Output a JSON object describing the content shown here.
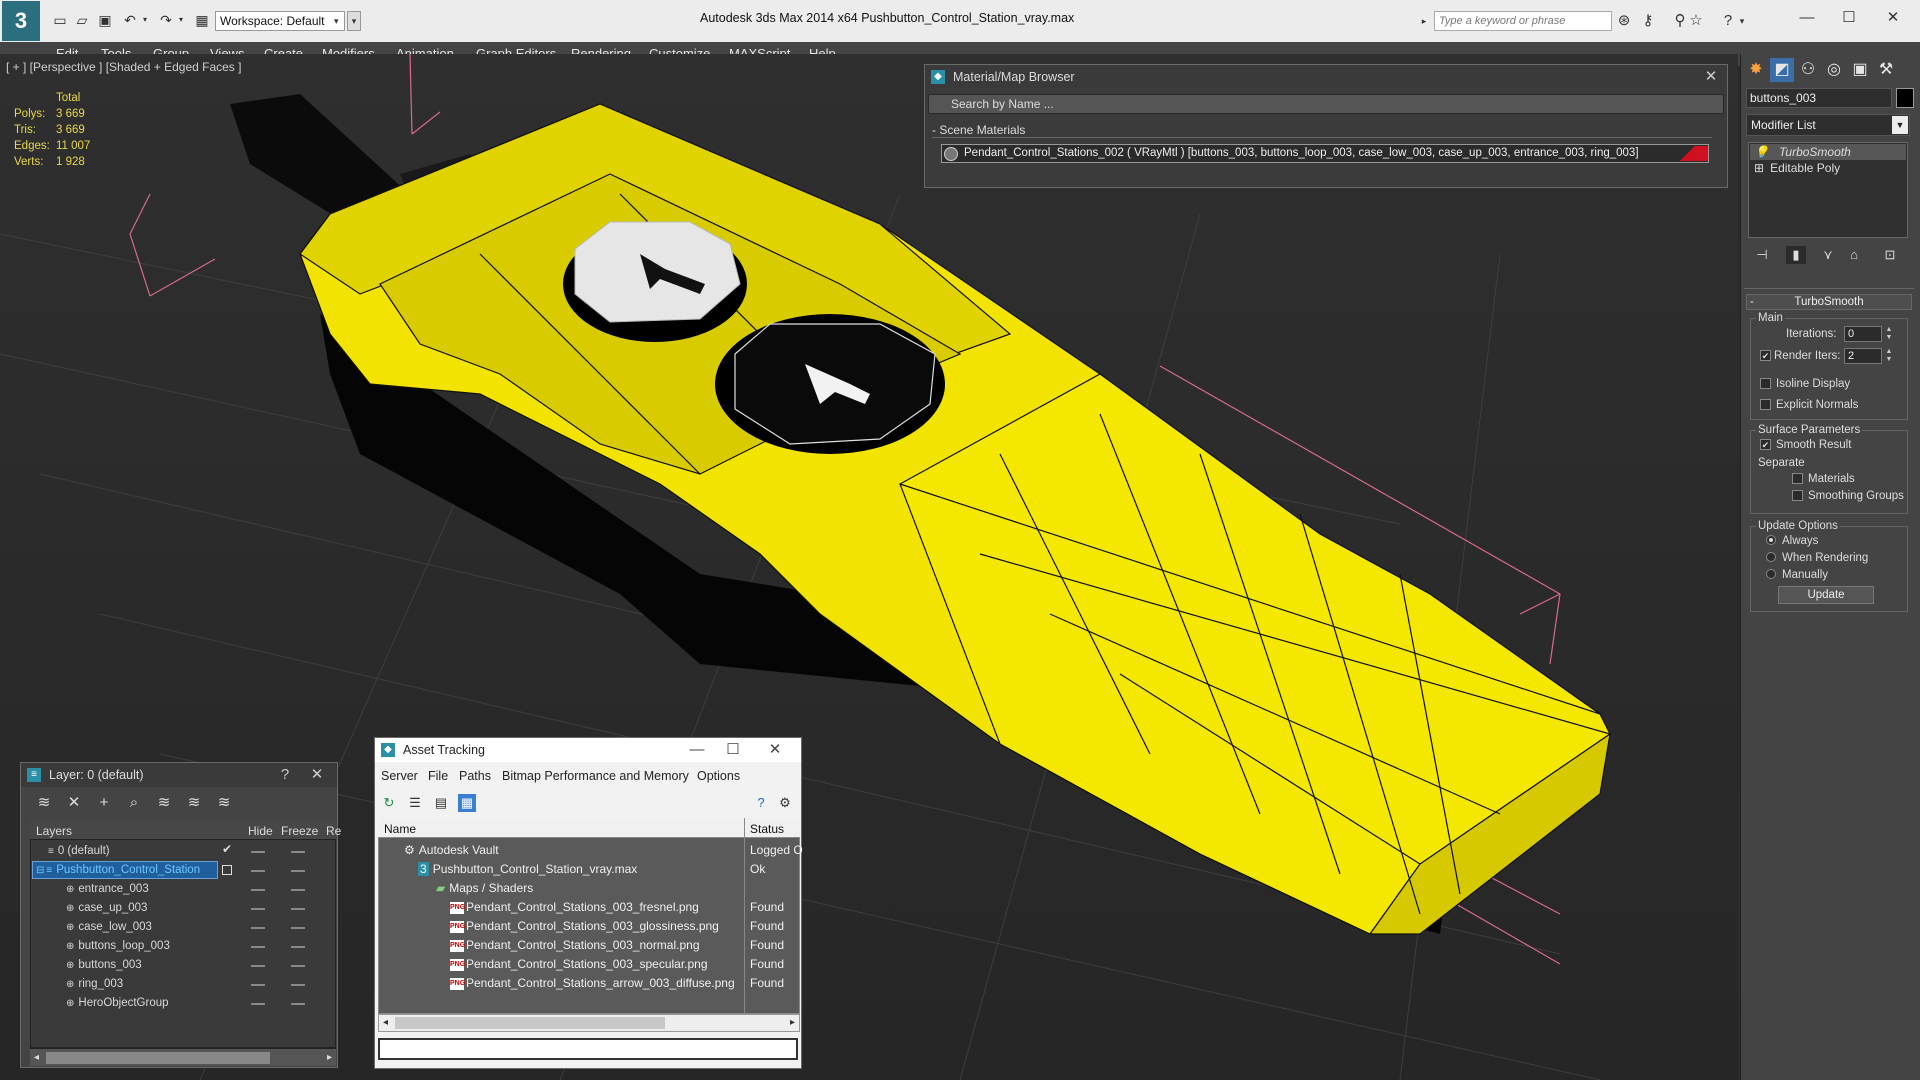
{
  "titlebar": {
    "workspace": "Workspace: Default",
    "app_title": "Autodesk 3ds Max  2014 x64      Pushbutton_Control_Station_vray.max",
    "search_placeholder": "Type a keyword or phrase"
  },
  "menu": [
    "Edit",
    "Tools",
    "Group",
    "Views",
    "Create",
    "Modifiers",
    "Animation",
    "Graph Editors",
    "Rendering",
    "Customize",
    "MAXScript",
    "Help"
  ],
  "viewport": {
    "label": "[ + ] [Perspective ] [Shaded + Edged Faces ]",
    "stats": {
      "header": "Total",
      "polys_label": "Polys:",
      "polys": "3 669",
      "tris_label": "Tris:",
      "tris": "3 669",
      "edges_label": "Edges:",
      "edges": "11 007",
      "verts_label": "Verts:",
      "verts": "1 928"
    }
  },
  "material_browser": {
    "title": "Material/Map Browser",
    "search_placeholder": "Search by Name ...",
    "section": "- Scene Materials",
    "material_row": "Pendant_Control_Stations_002  ( VRayMtl )  [buttons_003, buttons_loop_003, case_low_003, case_up_003, entrance_003, ring_003]",
    "swatch_color": "#d01020"
  },
  "layer_manager": {
    "title": "Layer: 0 (default)",
    "help": "?",
    "columns": {
      "layers": "Layers",
      "hide": "Hide",
      "freeze": "Freeze",
      "render": "Re"
    },
    "rows": [
      {
        "name": "0 (default)"
      },
      {
        "name": "Pushbutton_Control_Station"
      },
      {
        "name": "entrance_003"
      },
      {
        "name": "case_up_003"
      },
      {
        "name": "case_low_003"
      },
      {
        "name": "buttons_loop_003"
      },
      {
        "name": "buttons_003"
      },
      {
        "name": "ring_003"
      },
      {
        "name": "HeroObjectGroup"
      }
    ]
  },
  "asset_tracking": {
    "title": "Asset Tracking",
    "menu": [
      "Server",
      "File",
      "Paths",
      "Bitmap Performance and Memory",
      "Options"
    ],
    "columns": {
      "name": "Name",
      "status": "Status"
    },
    "rows": [
      {
        "name": "Autodesk Vault",
        "status": "Logged O"
      },
      {
        "name": "Pushbutton_Control_Station_vray.max",
        "status": "Ok"
      },
      {
        "name": "Maps / Shaders",
        "status": ""
      },
      {
        "name": "Pendant_Control_Stations_003_fresnel.png",
        "status": "Found"
      },
      {
        "name": "Pendant_Control_Stations_003_glossiness.png",
        "status": "Found"
      },
      {
        "name": "Pendant_Control_Stations_003_normal.png",
        "status": "Found"
      },
      {
        "name": "Pendant_Control_Stations_003_specular.png",
        "status": "Found"
      },
      {
        "name": "Pendant_Control_Stations_arrow_003_diffuse.png",
        "status": "Found"
      }
    ],
    "png_badge": "PNG"
  },
  "command_panel": {
    "object_name": "buttons_003",
    "modifier_list": "Modifier List",
    "stack": [
      "TurboSmooth",
      "Editable Poly"
    ],
    "rollout": "TurboSmooth",
    "main_label": "Main",
    "iterations_label": "Iterations:",
    "iterations": "0",
    "render_iters_label": "Render Iters:",
    "render_iters": "2",
    "isoline": "Isoline Display",
    "explicit_normals": "Explicit Normals",
    "surface_params": "Surface Parameters",
    "smooth_result": "Smooth Result",
    "separate": "Separate",
    "materials": "Materials",
    "smoothing_groups": "Smoothing Groups",
    "update_options": "Update Options",
    "always": "Always",
    "when_rendering": "When Rendering",
    "manually": "Manually",
    "update_button": "Update"
  },
  "colors": {
    "accent": "#2b8fa8",
    "model_yellow": "#f2e400",
    "stats_yellow": "#e8d84a"
  }
}
